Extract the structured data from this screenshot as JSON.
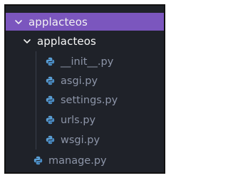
{
  "explorer": {
    "root_folder": {
      "label": "applacteos",
      "expanded": true,
      "icon": "chevron-down-icon"
    },
    "package_folder": {
      "label": "applacteos",
      "expanded": true,
      "icon": "chevron-down-icon"
    },
    "package_files": [
      {
        "label": "__init__.py",
        "icon": "python-file-icon"
      },
      {
        "label": "asgi.py",
        "icon": "python-file-icon"
      },
      {
        "label": "settings.py",
        "icon": "python-file-icon"
      },
      {
        "label": "urls.py",
        "icon": "python-file-icon"
      },
      {
        "label": "wsgi.py",
        "icon": "python-file-icon"
      }
    ],
    "root_files": [
      {
        "label": "manage.py",
        "icon": "python-file-icon"
      }
    ]
  },
  "colors": {
    "panel_bg": "#1f2229",
    "selected_bg": "#7b56be",
    "folder_text": "#f2f2f2",
    "file_text": "#8d95a8",
    "python_icon": "#5a9fd6"
  }
}
